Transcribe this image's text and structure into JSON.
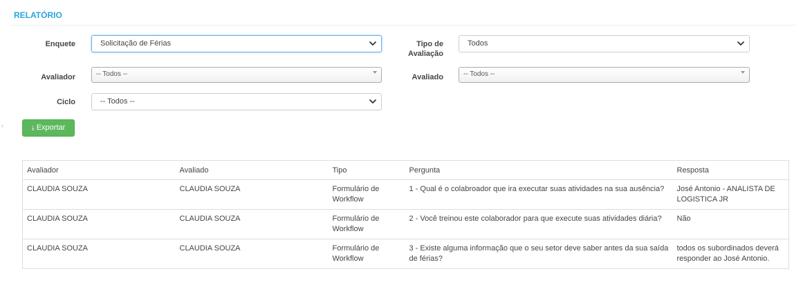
{
  "header": {
    "title": "RELATÓRIO"
  },
  "filters": {
    "enquete": {
      "label": "Enquete",
      "value": "Solicitação de Férias"
    },
    "tipo_avaliacao": {
      "label_line1": "Tipo de",
      "label_line2": "Avaliação",
      "value": "Todos"
    },
    "avaliador": {
      "label": "Avaliador",
      "value": "-- Todos --"
    },
    "avaliado": {
      "label": "Avaliado",
      "value": "-- Todos --"
    },
    "ciclo": {
      "label": "Ciclo",
      "value": "-- Todos --"
    }
  },
  "actions": {
    "export_label": "Exportar",
    "export_icon": "download-icon"
  },
  "table": {
    "columns": [
      "Avaliador",
      "Avaliado",
      "Tipo",
      "Pergunta",
      "Resposta"
    ],
    "rows": [
      [
        "CLAUDIA SOUZA",
        "CLAUDIA SOUZA",
        "Formulário de Workflow",
        "1 - Qual é o colabroador que ira executar suas atividades na sua ausência?",
        "José Antonio - ANALISTA DE LOGISTICA JR"
      ],
      [
        "CLAUDIA SOUZA",
        "CLAUDIA SOUZA",
        "Formulário de Workflow",
        "2 - Você treinou este colaborador para que execute suas atividades diária?",
        "Não"
      ],
      [
        "CLAUDIA SOUZA",
        "CLAUDIA SOUZA",
        "Formulário de Workflow",
        "3 - Existe alguma informação que o seu setor deve saber antes da sua saída de férias?",
        "todos os subordinados deverá responder ao José Antonio."
      ]
    ]
  },
  "colors": {
    "accent": "#29a3e0",
    "export_button": "#5cb85c",
    "focus_border": "#66afe9"
  }
}
